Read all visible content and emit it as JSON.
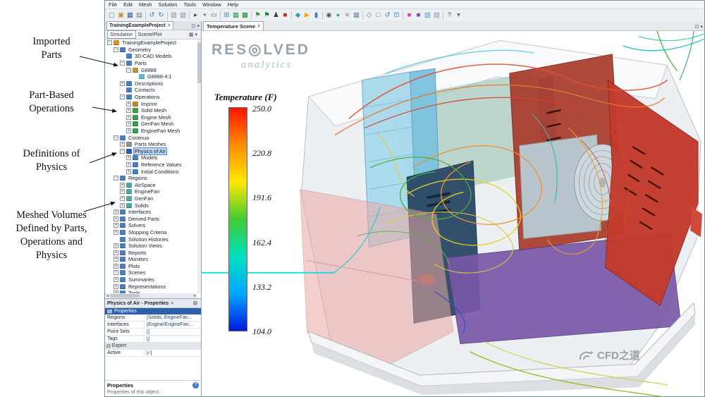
{
  "annotations": {
    "arrow_color": "#111111",
    "items": [
      {
        "text": "Imported\nParts"
      },
      {
        "text": "Part-Based\nOperations"
      },
      {
        "text": "Definitions of\nPhysics"
      },
      {
        "text": "Meshed Volumes\nDefined by Parts,\nOperations and\nPhysics"
      }
    ]
  },
  "chrome": {
    "close": "×",
    "dock": "⊡",
    "dropdown": "▾",
    "minimize": "⊟",
    "grid": "▦",
    "left_arrow": "◂",
    "right_arrow": "▸"
  },
  "app": {
    "menu": [
      "File",
      "Edit",
      "Mesh",
      "Solution",
      "Tools",
      "Window",
      "Help"
    ],
    "toolbar": [
      {
        "name": "new-simulation",
        "glyph": "▢",
        "color": "#4a78b8"
      },
      {
        "name": "open-simulation",
        "glyph": "▣",
        "color": "#c89040"
      },
      {
        "name": "save-simulation",
        "glyph": "▦",
        "color": "#3060a8"
      },
      {
        "name": "print",
        "glyph": "▤",
        "color": "#70787f"
      },
      {
        "sep": true
      },
      {
        "name": "undo",
        "glyph": "↺",
        "color": "#3878c8"
      },
      {
        "name": "redo",
        "glyph": "↻",
        "color": "#3878c8"
      },
      {
        "sep": true
      },
      {
        "name": "copy",
        "glyph": "▥",
        "color": "#8090a0"
      },
      {
        "name": "paste",
        "glyph": "▧",
        "color": "#8090a0"
      },
      {
        "sep": true
      },
      {
        "name": "select-tool",
        "glyph": "▸",
        "color": "#404850"
      },
      {
        "name": "probe-tool",
        "glyph": "⌖",
        "color": "#405868"
      },
      {
        "name": "zoom-box-tool",
        "glyph": "▭",
        "color": "#405868"
      },
      {
        "sep": true
      },
      {
        "name": "create-scene",
        "glyph": "⊞",
        "color": "#4888c8"
      },
      {
        "name": "generate-surface-mesh",
        "glyph": "▦",
        "color": "#28a048"
      },
      {
        "name": "generate-volume-mesh",
        "glyph": "▩",
        "color": "#188838"
      },
      {
        "sep": true
      },
      {
        "name": "start-flag",
        "glyph": "⚑",
        "color": "#20a030"
      },
      {
        "name": "checkpoint-flag",
        "glyph": "⚑",
        "color": "#107828"
      },
      {
        "name": "run-person",
        "glyph": "♟",
        "color": "#303840"
      },
      {
        "name": "stop-solver",
        "glyph": "■",
        "color": "#c02818"
      },
      {
        "sep": true
      },
      {
        "name": "initialize-solution",
        "glyph": "◆",
        "color": "#3890c8"
      },
      {
        "name": "run-simulation",
        "glyph": "▶",
        "color": "#f0a818"
      },
      {
        "name": "step-simulation",
        "glyph": "▮",
        "color": "#3878c8"
      },
      {
        "sep": true
      },
      {
        "name": "camera",
        "glyph": "◉",
        "color": "#505860"
      },
      {
        "name": "snapshot",
        "glyph": "●",
        "color": "#38a0c8"
      },
      {
        "name": "measure",
        "glyph": "≡",
        "color": "#788898"
      },
      {
        "name": "grid-toggle",
        "glyph": "▦",
        "color": "#7088a0"
      },
      {
        "sep": true
      },
      {
        "name": "view-iso",
        "glyph": "◇",
        "color": "#607890"
      },
      {
        "name": "view-front",
        "glyph": "□",
        "color": "#607890"
      },
      {
        "name": "reset-view",
        "glyph": "↺",
        "color": "#2878c0"
      },
      {
        "name": "fit-view",
        "glyph": "⊡",
        "color": "#2878c0"
      },
      {
        "sep": true
      },
      {
        "name": "color-swatch-pink",
        "glyph": "■",
        "color": "#e040c0"
      },
      {
        "name": "color-swatch-purple",
        "glyph": "■",
        "color": "#8040c0"
      },
      {
        "name": "texture",
        "glyph": "▨",
        "color": "#40a0c0"
      },
      {
        "name": "background-color",
        "glyph": "▧",
        "color": "#8098a8"
      },
      {
        "sep": true
      },
      {
        "name": "help",
        "glyph": "?",
        "color": "#3060c0"
      },
      {
        "name": "toolbar-options",
        "glyph": "▾",
        "color": "#606870"
      }
    ]
  },
  "explorer": {
    "tab": "TrainingExampleProject",
    "view_buttons": [
      "Simulation",
      "Scene/Plot"
    ],
    "tree": [
      {
        "label": "TrainingExampleProject",
        "indent": 0,
        "exp": "-",
        "icon": "simulation",
        "color": "#d09020",
        "sel": false
      },
      {
        "label": "Geometry",
        "indent": 1,
        "exp": "-",
        "icon": "folder",
        "color": "#4a7ec0",
        "sel": false
      },
      {
        "label": "3D-CAD Models",
        "indent": 2,
        "exp": "",
        "icon": "folder",
        "color": "#4a7ec0",
        "sel": false
      },
      {
        "label": "Parts",
        "indent": 2,
        "exp": "-",
        "icon": "folder",
        "color": "#4a7ec0",
        "sel": false
      },
      {
        "label": "G8888",
        "indent": 3,
        "exp": "-",
        "icon": "part",
        "color": "#b09a40",
        "sel": false
      },
      {
        "label": "G8888-4:1",
        "indent": 4,
        "exp": "",
        "icon": "part-instance",
        "color": "#68b4d8",
        "sel": false
      },
      {
        "label": "Descriptions",
        "indent": 2,
        "exp": "+",
        "icon": "folder",
        "color": "#4a7ec0",
        "sel": false
      },
      {
        "label": "Contacts",
        "indent": 2,
        "exp": "",
        "icon": "folder",
        "color": "#4a7ec0",
        "sel": false
      },
      {
        "label": "Operations",
        "indent": 2,
        "exp": "-",
        "icon": "folder",
        "color": "#4a7ec0",
        "sel": false
      },
      {
        "label": "Imprint",
        "indent": 3,
        "exp": "+",
        "icon": "operation",
        "color": "#c08828",
        "sel": false
      },
      {
        "label": "Solid Mesh",
        "indent": 3,
        "exp": "+",
        "icon": "mesh-operation",
        "color": "#38a048",
        "sel": false
      },
      {
        "label": "Engine Mesh",
        "indent": 3,
        "exp": "+",
        "icon": "mesh-operation",
        "color": "#38a048",
        "sel": false
      },
      {
        "label": "GenFan Mesh",
        "indent": 3,
        "exp": "+",
        "icon": "mesh-operation",
        "color": "#38a048",
        "sel": false
      },
      {
        "label": "EngineFan Mesh",
        "indent": 3,
        "exp": "+",
        "icon": "mesh-operation",
        "color": "#38a048",
        "sel": false
      },
      {
        "label": "Continua",
        "indent": 1,
        "exp": "-",
        "icon": "folder",
        "color": "#4a7ec0",
        "sel": false
      },
      {
        "label": "Parts Meshes",
        "indent": 2,
        "exp": "+",
        "icon": "mesh-continuum",
        "color": "#8a9298",
        "sel": false
      },
      {
        "label": "Physics of Air",
        "indent": 2,
        "exp": "-",
        "icon": "physics-continuum",
        "color": "#2858c0",
        "sel": true
      },
      {
        "label": "Models",
        "indent": 3,
        "exp": "+",
        "icon": "folder",
        "color": "#4a7ec0",
        "sel": false
      },
      {
        "label": "Reference Values",
        "indent": 3,
        "exp": "+",
        "icon": "folder",
        "color": "#4a7ec0",
        "sel": false
      },
      {
        "label": "Initial Conditions",
        "indent": 3,
        "exp": "+",
        "icon": "folder",
        "color": "#4a7ec0",
        "sel": false
      },
      {
        "label": "Regions",
        "indent": 1,
        "exp": "-",
        "icon": "folder",
        "color": "#4a7ec0",
        "sel": false
      },
      {
        "label": "AirSpace",
        "indent": 2,
        "exp": "+",
        "icon": "region",
        "color": "#50a8a0",
        "sel": false
      },
      {
        "label": "EngineFan",
        "indent": 2,
        "exp": "+",
        "icon": "region",
        "color": "#50a8a0",
        "sel": false
      },
      {
        "label": "GenFan",
        "indent": 2,
        "exp": "+",
        "icon": "region",
        "color": "#50a8a0",
        "sel": false
      },
      {
        "label": "Solids",
        "indent": 2,
        "exp": "+",
        "icon": "region",
        "color": "#50a8a0",
        "sel": false
      },
      {
        "label": "Interfaces",
        "indent": 1,
        "exp": "+",
        "icon": "folder",
        "color": "#4a7ec0",
        "sel": false
      },
      {
        "label": "Derived Parts",
        "indent": 1,
        "exp": "+",
        "icon": "folder",
        "color": "#4a7ec0",
        "sel": false
      },
      {
        "label": "Solvers",
        "indent": 1,
        "exp": "+",
        "icon": "folder",
        "color": "#4a7ec0",
        "sel": false
      },
      {
        "label": "Stopping Criteria",
        "indent": 1,
        "exp": "+",
        "icon": "folder",
        "color": "#4a7ec0",
        "sel": false
      },
      {
        "label": "Solution Histories",
        "indent": 1,
        "exp": "",
        "icon": "folder",
        "color": "#4a7ec0",
        "sel": false
      },
      {
        "label": "Solution Views",
        "indent": 1,
        "exp": "+",
        "icon": "folder",
        "color": "#4a7ec0",
        "sel": false
      },
      {
        "label": "Reports",
        "indent": 1,
        "exp": "+",
        "icon": "folder",
        "color": "#4a7ec0",
        "sel": false
      },
      {
        "label": "Monitors",
        "indent": 1,
        "exp": "+",
        "icon": "folder",
        "color": "#4a7ec0",
        "sel": false
      },
      {
        "label": "Plots",
        "indent": 1,
        "exp": "+",
        "icon": "folder",
        "color": "#4a7ec0",
        "sel": false
      },
      {
        "label": "Scenes",
        "indent": 1,
        "exp": "-",
        "icon": "folder",
        "color": "#4a7ec0",
        "sel": false
      },
      {
        "label": "Summaries",
        "indent": 1,
        "exp": "+",
        "icon": "folder",
        "color": "#4a7ec0",
        "sel": false
      },
      {
        "label": "Representations",
        "indent": 1,
        "exp": "+",
        "icon": "folder",
        "color": "#4a7ec0",
        "sel": false
      },
      {
        "label": "Tools",
        "indent": 1,
        "exp": "+",
        "icon": "folder",
        "color": "#4a7ec0",
        "sel": false
      }
    ]
  },
  "properties": {
    "title": "Physics of Air - Properties",
    "section": "Properties",
    "rows": [
      {
        "label": "Regions",
        "value": "[Solids, EngineFan..."
      },
      {
        "label": "Interfaces",
        "value": "[Engine/EngineFan..."
      },
      {
        "label": "Point Sets",
        "value": "[]"
      },
      {
        "label": "Tags",
        "value": "[]"
      }
    ],
    "expert_label": "Expert",
    "active_label": "Active",
    "active_checked": "✓",
    "help_glyph": "?",
    "footer_title": "Properties",
    "footer_text": "Properties of this object."
  },
  "scene": {
    "tab": "Temperature Scene",
    "logo": "RES◎LVED",
    "logo_sub": "analytics",
    "legend": {
      "title": "Temperature (F)",
      "ticks": [
        "250.0",
        "220.8",
        "191.6",
        "162.4",
        "133.2",
        "104.0"
      ],
      "colors": [
        "#ff1400",
        "#ff8c00",
        "#ffe800",
        "#40cc30",
        "#00e0c0",
        "#00a8ff",
        "#0018e0"
      ]
    }
  },
  "watermark": {
    "text": "CFD之道"
  }
}
